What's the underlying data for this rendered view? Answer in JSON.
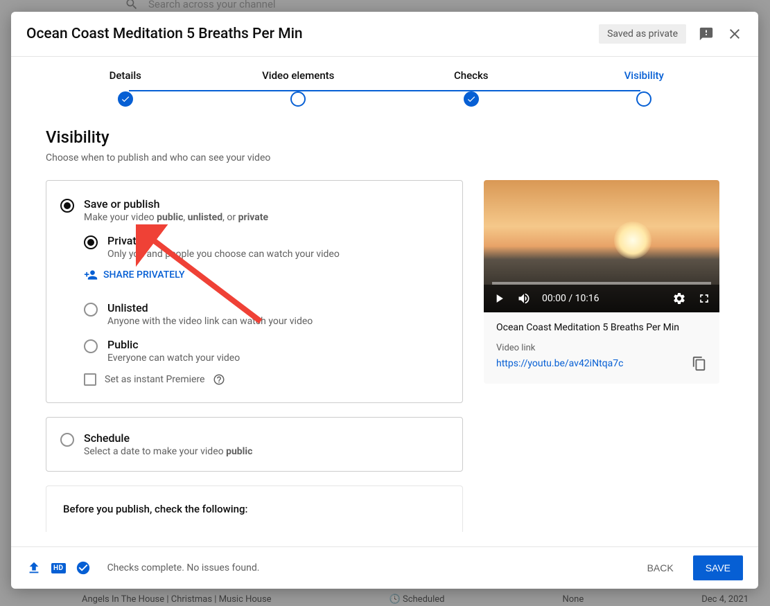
{
  "background": {
    "search_placeholder": "Search across your channel",
    "row": {
      "title": "Angels In The House | Christmas | Music House",
      "status": "Scheduled",
      "restriction": "None",
      "date": "Dec 4, 2021"
    }
  },
  "dialog": {
    "title": "Ocean Coast Meditation 5 Breaths Per Min",
    "saved_badge": "Saved as private",
    "steps": [
      "Details",
      "Video elements",
      "Checks",
      "Visibility"
    ],
    "active_step": 3
  },
  "visibility": {
    "heading": "Visibility",
    "sub": "Choose when to publish and who can see your video",
    "save_or_publish": {
      "label": "Save or publish",
      "sub_prefix": "Make your video ",
      "sub_b1": "public",
      "sub_b2": "unlisted",
      "sub_or": ", or ",
      "sub_b3": "private",
      "options": {
        "private": {
          "label": "Private",
          "sub": "Only you and people you choose can watch your video",
          "share": "SHARE PRIVATELY"
        },
        "unlisted": {
          "label": "Unlisted",
          "sub": "Anyone with the video link can watch your video"
        },
        "public": {
          "label": "Public",
          "sub": "Everyone can watch your video",
          "premiere": "Set as instant Premiere"
        }
      }
    },
    "schedule": {
      "label": "Schedule",
      "sub_prefix": "Select a date to make your video ",
      "sub_b": "public"
    },
    "before_publish": "Before you publish, check the following:"
  },
  "preview": {
    "time": "00:00 / 10:16",
    "title": "Ocean Coast Meditation 5 Breaths Per Min",
    "link_label": "Video link",
    "link": "https://youtu.be/av42iNtqa7c"
  },
  "footer": {
    "status": "Checks complete. No issues found.",
    "back": "BACK",
    "save": "SAVE"
  }
}
